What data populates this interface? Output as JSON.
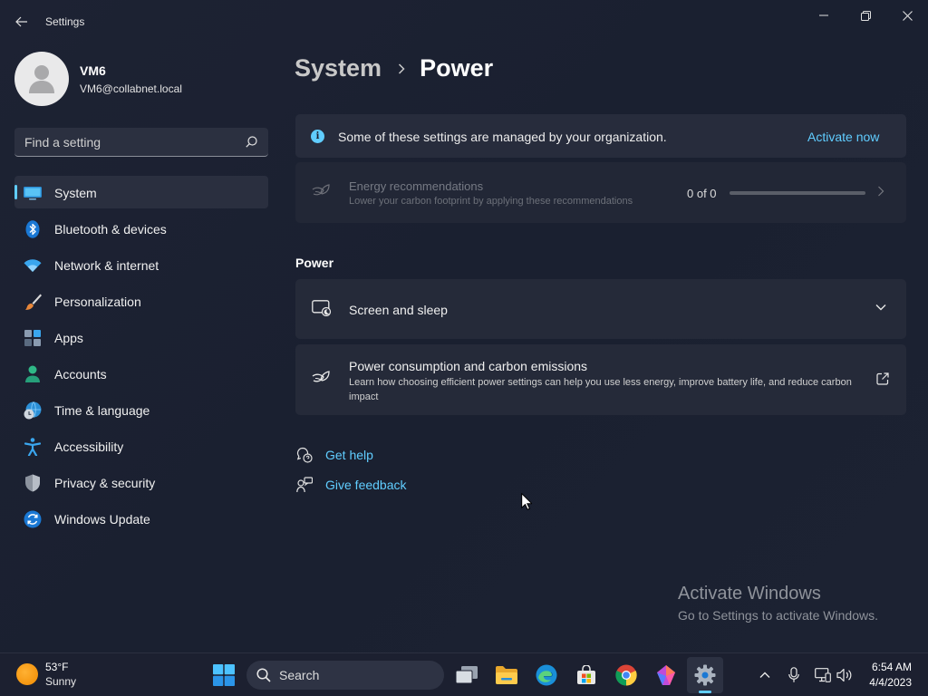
{
  "window": {
    "app_title": "Settings"
  },
  "profile": {
    "name": "VM6",
    "email": "VM6@collabnet.local"
  },
  "search": {
    "placeholder": "Find a setting"
  },
  "nav": {
    "items": [
      {
        "label": "System",
        "icon": "system-monitor-icon",
        "active": true
      },
      {
        "label": "Bluetooth & devices",
        "icon": "bluetooth-icon"
      },
      {
        "label": "Network & internet",
        "icon": "wifi-icon"
      },
      {
        "label": "Personalization",
        "icon": "paintbrush-icon"
      },
      {
        "label": "Apps",
        "icon": "apps-grid-icon"
      },
      {
        "label": "Accounts",
        "icon": "person-icon"
      },
      {
        "label": "Time & language",
        "icon": "globe-clock-icon"
      },
      {
        "label": "Accessibility",
        "icon": "accessibility-icon"
      },
      {
        "label": "Privacy & security",
        "icon": "shield-icon"
      },
      {
        "label": "Windows Update",
        "icon": "refresh-icon"
      }
    ]
  },
  "breadcrumb": {
    "parent": "System",
    "current": "Power"
  },
  "banner": {
    "text": "Some of these settings are managed by your organization.",
    "link": "Activate now"
  },
  "energy": {
    "title": "Energy recommendations",
    "subtitle": "Lower your carbon footprint by applying these recommendations",
    "count": "0 of 0",
    "progress": 0
  },
  "power_section": {
    "title": "Power",
    "screen_sleep": "Screen and sleep",
    "carbon_title": "Power consumption and carbon emissions",
    "carbon_sub": "Learn how choosing efficient power settings can help you use less energy, improve battery life, and reduce carbon impact"
  },
  "help": {
    "get_help": "Get help",
    "give_feedback": "Give feedback"
  },
  "watermark": {
    "title": "Activate Windows",
    "subtitle": "Go to Settings to activate Windows."
  },
  "taskbar": {
    "weather_temp": "53°F",
    "weather_condition": "Sunny",
    "search_label": "Search",
    "time": "6:54 AM",
    "date": "4/4/2023"
  },
  "colors": {
    "accent": "#60cdff",
    "background": "#1b2030",
    "card": "#252a39"
  }
}
